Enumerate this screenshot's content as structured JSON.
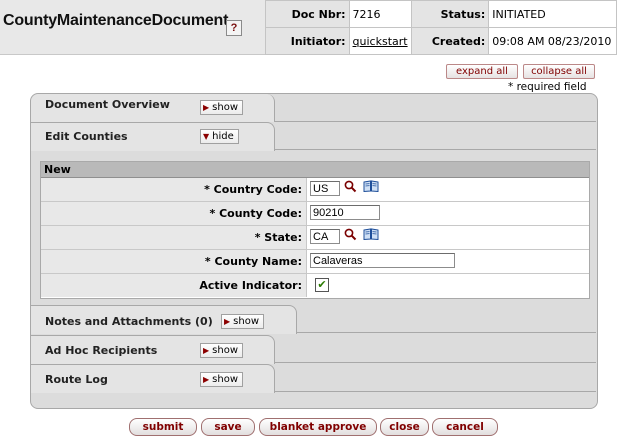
{
  "header": {
    "title": "CountyMaintenanceDocument",
    "help_glyph": "?",
    "doc_nbr_label": "Doc Nbr:",
    "doc_nbr": "7216",
    "status_label": "Status:",
    "status": "INITIATED",
    "initiator_label": "Initiator:",
    "initiator": "quickstart",
    "created_label": "Created:",
    "created": "09:08 AM 08/23/2010"
  },
  "controls": {
    "expand_all": "expand all",
    "collapse_all": "collapse all",
    "required_note": "* required field"
  },
  "tabs": [
    {
      "label": "Document Overview",
      "toggle": "show"
    },
    {
      "label": "Edit Counties",
      "toggle": "hide"
    },
    {
      "label": "Notes and Attachments (0)",
      "toggle": "show"
    },
    {
      "label": "Ad Hoc Recipients",
      "toggle": "show"
    },
    {
      "label": "Route Log",
      "toggle": "show"
    }
  ],
  "form": {
    "section_title": "New",
    "fields": [
      {
        "label": "*  Country Code:",
        "value": "US"
      },
      {
        "label": "*  County Code:",
        "value": "90210"
      },
      {
        "label": "*  State:",
        "value": "CA"
      },
      {
        "label": "*  County Name:",
        "value": "Calaveras"
      },
      {
        "label": "Active Indicator:",
        "checked": true
      }
    ]
  },
  "buttons": {
    "submit": "submit",
    "save": "save",
    "blanket_approve": "blanket approve",
    "close": "close",
    "cancel": "cancel"
  },
  "colors": {
    "button_text": "#800000",
    "panel_bg": "#dcdcdc",
    "label_bg": "#e8e8e8",
    "form_header_bg": "#b9b9b9"
  }
}
